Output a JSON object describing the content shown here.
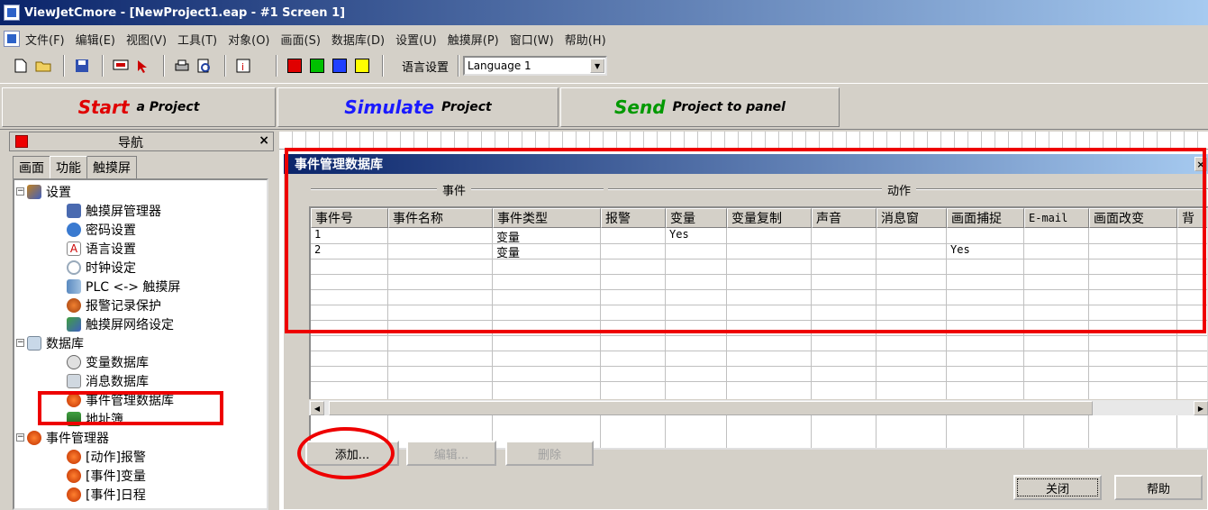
{
  "window": {
    "title": "ViewJetCmore - [NewProject1.eap - #1 Screen 1]"
  },
  "menu": [
    "文件(F)",
    "编辑(E)",
    "视图(V)",
    "工具(T)",
    "对象(O)",
    "画面(S)",
    "数据库(D)",
    "设置(U)",
    "触摸屏(P)",
    "窗口(W)",
    "帮助(H)"
  ],
  "toolbar": {
    "icons": [
      "new-file-icon",
      "open-folder-icon",
      "save-icon",
      "screen-icon",
      "cursor-icon",
      "print-icon",
      "print-preview-icon",
      "info-icon"
    ],
    "color_squares": [
      "#e00000",
      "#00c000",
      "#2040ff",
      "#ffff00"
    ],
    "language_label": "语言设置",
    "language_value": "Language 1"
  },
  "big_buttons": {
    "start_big": "Start",
    "start_small": "a Project",
    "start_color": "#e00000",
    "simulate_big": "Simulate",
    "simulate_small": "Project",
    "simulate_color": "#1a1aff",
    "send_big": "Send",
    "send_small": "Project to panel",
    "send_color": "#009900"
  },
  "nav": {
    "title": "导航",
    "close": "×",
    "tabs": [
      "画面",
      "功能",
      "触摸屏"
    ],
    "tree": [
      {
        "label": "设置",
        "icon": "settings-icon",
        "level": 0,
        "toggle": "−"
      },
      {
        "label": "触摸屏管理器",
        "icon": "panel-manager-icon",
        "level": 1
      },
      {
        "label": "密码设置",
        "icon": "password-icon",
        "level": 1
      },
      {
        "label": "语言设置",
        "icon": "language-icon",
        "level": 1
      },
      {
        "label": "时钟设定",
        "icon": "clock-icon",
        "level": 1
      },
      {
        "label": "PLC <-> 触摸屏",
        "icon": "plc-link-icon",
        "level": 1
      },
      {
        "label": "报警记录保护",
        "icon": "alarm-log-icon",
        "level": 1
      },
      {
        "label": "触摸屏网络设定",
        "icon": "network-icon",
        "level": 1
      },
      {
        "label": "数据库",
        "icon": "database-icon",
        "level": 0,
        "toggle": "−"
      },
      {
        "label": "变量数据库",
        "icon": "variable-db-icon",
        "level": 1
      },
      {
        "label": "消息数据库",
        "icon": "message-db-icon",
        "level": 1
      },
      {
        "label": "事件管理数据库",
        "icon": "event-db-icon",
        "level": 1
      },
      {
        "label": "地址簿",
        "icon": "address-book-icon",
        "level": 1
      },
      {
        "label": "事件管理器",
        "icon": "event-manager-icon",
        "level": 0,
        "toggle": "−"
      },
      {
        "label": "[动作]报警",
        "icon": "event-item-icon",
        "level": 1
      },
      {
        "label": "[事件]变量",
        "icon": "event-item-icon",
        "level": 1
      },
      {
        "label": "[事件]日程",
        "icon": "event-item-icon",
        "level": 1
      }
    ]
  },
  "dialog": {
    "title": "事件管理数据库",
    "close": "×",
    "group_event": "事件",
    "group_action": "动作",
    "columns": [
      "事件号",
      "事件名称",
      "事件类型",
      "报警",
      "变量",
      "变量复制",
      "声音",
      "消息窗",
      "画面捕捉",
      "E-mail",
      "画面改变",
      "背"
    ],
    "rows": [
      [
        "1",
        "",
        "变量",
        "",
        "Yes",
        "",
        "",
        "",
        "",
        "",
        "",
        ""
      ],
      [
        "2",
        "",
        "变量",
        "",
        "",
        "",
        "",
        "",
        "Yes",
        "",
        "",
        ""
      ]
    ],
    "buttons": {
      "add": "添加...",
      "edit": "编辑...",
      "delete": "删除",
      "close": "关闭",
      "help": "帮助"
    }
  }
}
